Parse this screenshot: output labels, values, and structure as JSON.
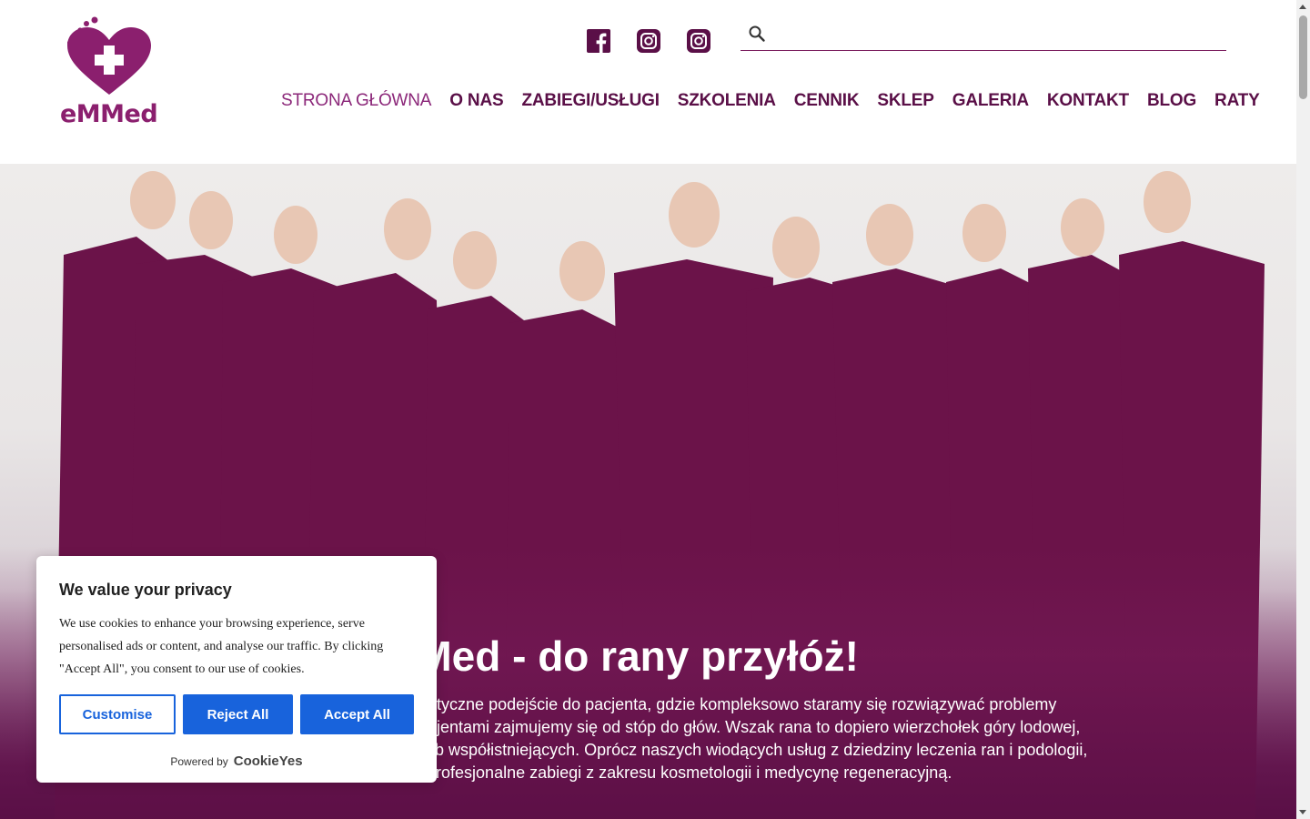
{
  "brand": {
    "logo_text": "eMMed",
    "color": "#8b1f6e"
  },
  "social": [
    {
      "name": "facebook",
      "icon": "facebook-icon"
    },
    {
      "name": "instagram",
      "icon": "instagram-icon"
    },
    {
      "name": "instagram",
      "icon": "instagram-icon"
    }
  ],
  "search": {
    "placeholder": "",
    "value": ""
  },
  "nav": [
    {
      "label": "STRONA GŁÓWNA",
      "active": true
    },
    {
      "label": "O NAS"
    },
    {
      "label": "ZABIEGI/USŁUGI"
    },
    {
      "label": "SZKOLENIA"
    },
    {
      "label": "CENNIK"
    },
    {
      "label": "SKLEP"
    },
    {
      "label": "GALERIA"
    },
    {
      "label": "KONTAKT"
    },
    {
      "label": "BLOG"
    },
    {
      "label": "RATY"
    }
  ],
  "hero": {
    "title": "MMed - do rany przyłóż!",
    "text_lines": [
      "na holistyczne podejście do pacjenta, gdzie kompleksowo staramy się rozwiązywać problemy",
      "ymi pacjentami zajmujemy się od stóp do głów. Wszak rana to dopiero wierzchołek góry lodowej,",
      "a chorób współistniejących. Oprócz naszych wiodących usług z dziedziny leczenia ran i podologii,",
      "wnież profesjonalne zabiegi z zakresu kosmetologii i medycynę regeneracyjną."
    ],
    "scrub_color": "#6b1349"
  },
  "cookie": {
    "title": "We value your privacy",
    "text_lines": [
      "We use cookies to enhance your browsing experience, serve",
      "personalised ads or content, and analyse our traffic. By clicking",
      "\"Accept All\", you consent to our use of cookies."
    ],
    "customise_label": "Customise",
    "reject_label": "Reject All",
    "accept_label": "Accept All",
    "powered_label": "Powered by",
    "powered_brand": "CookieYes",
    "accent": "#1863dc"
  }
}
